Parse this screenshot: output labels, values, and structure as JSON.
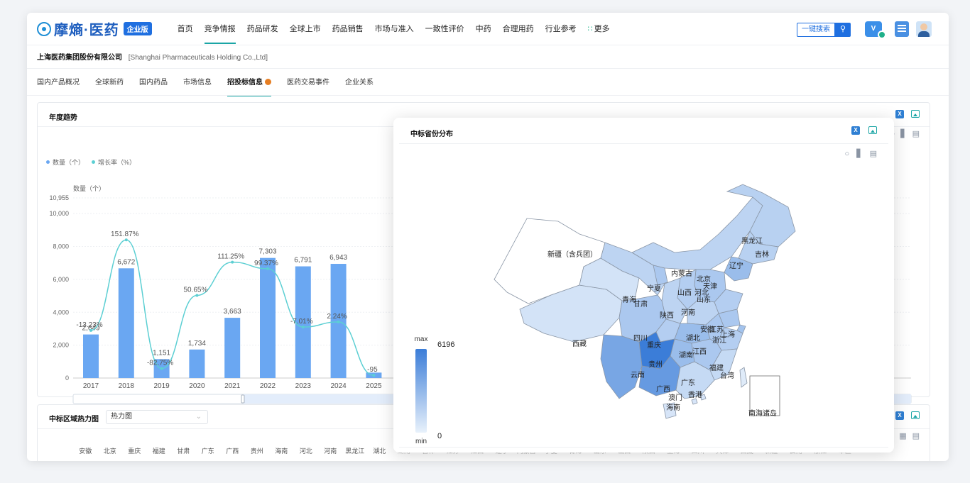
{
  "nav": {
    "brand": "摩熵·医药",
    "badge": "企业版",
    "items": [
      {
        "label": "首页",
        "active": false
      },
      {
        "label": "竞争情报",
        "active": true
      },
      {
        "label": "药品研发",
        "active": false
      },
      {
        "label": "全球上市",
        "active": false
      },
      {
        "label": "药品销售",
        "active": false
      },
      {
        "label": "市场与准入",
        "active": false
      },
      {
        "label": "一致性评价",
        "active": false
      },
      {
        "label": "中药",
        "active": false
      },
      {
        "label": "合理用药",
        "active": false
      },
      {
        "label": "行业参考",
        "active": false
      }
    ],
    "more": "更多",
    "search_label": "一键搜索",
    "vip_label": "V"
  },
  "company": {
    "name_cn": "上海医药集团股份有限公司",
    "name_en": "[Shanghai Pharmaceuticals Holding Co.,Ltd]"
  },
  "subtabs": [
    {
      "label": "国内产品概况",
      "active": false
    },
    {
      "label": "全球新药",
      "active": false
    },
    {
      "label": "国内药品",
      "active": false
    },
    {
      "label": "市场信息",
      "active": false
    },
    {
      "label": "招投标信息",
      "active": true
    },
    {
      "label": "医药交易事件",
      "active": false
    },
    {
      "label": "企业关系",
      "active": false
    }
  ],
  "annual": {
    "title": "年度趋势",
    "legend_count": "数量（个）",
    "legend_rate": "增长率（%）",
    "ylabel": "数量（个）",
    "ymax_label": "10,955"
  },
  "chart_data": [
    {
      "type": "bar",
      "title": "年度趋势",
      "categories": [
        "2017",
        "2018",
        "2019",
        "2020",
        "2021",
        "2022",
        "2023",
        "2024",
        "2025"
      ],
      "series": [
        {
          "name": "数量（个）",
          "type": "bar",
          "values": [
            2649,
            6672,
            1151,
            1734,
            3663,
            7303,
            6791,
            6943,
            330
          ],
          "labels": [
            "2,649",
            "6,672",
            "1,151",
            "1,734",
            "3,663",
            "7,303",
            "6,791",
            "6,943",
            ""
          ]
        },
        {
          "name": "增长率（%）",
          "type": "line",
          "values": [
            -13.23,
            151.87,
            -82.75,
            50.65,
            111.25,
            99.37,
            -7.01,
            2.24,
            -95
          ],
          "labels": [
            "-13.23%",
            "151.87%",
            "-82.75%",
            "50.65%",
            "111.25%",
            "99.37%",
            "-7.01%",
            "2.24%",
            "-95"
          ]
        }
      ],
      "y_ticks": [
        "0",
        "2,000",
        "4,000",
        "6,000",
        "8,000",
        "10,000",
        "10,955"
      ],
      "ylim": [
        0,
        10955
      ],
      "rate_lim": [
        -100,
        200
      ],
      "ylabel": "数量（个）",
      "grid": true,
      "legend": "top-left"
    },
    {
      "type": "heatmap",
      "title": "中标省份分布",
      "legend_max_label": "max",
      "legend_min_label": "min",
      "max_value": "6196",
      "min_value": "0",
      "color_min": "#e8f1fb",
      "color_max": "#3b7dd8",
      "regions": [
        {
          "name": "新疆（含兵团）",
          "level": 0.0
        },
        {
          "name": "西藏",
          "level": 0.12
        },
        {
          "name": "青海",
          "level": 0.12
        },
        {
          "name": "甘肃",
          "level": 0.25
        },
        {
          "name": "内蒙古",
          "level": 0.25
        },
        {
          "name": "宁夏",
          "level": 0.35
        },
        {
          "name": "黑龙江",
          "level": 0.28
        },
        {
          "name": "吉林",
          "level": 0.28
        },
        {
          "name": "辽宁",
          "level": 0.45
        },
        {
          "name": "北京",
          "level": 0.3
        },
        {
          "name": "天津",
          "level": 0.3
        },
        {
          "name": "河北",
          "level": 0.35
        },
        {
          "name": "山西",
          "level": 0.3
        },
        {
          "name": "山东",
          "level": 0.3
        },
        {
          "name": "陕西",
          "level": 0.25
        },
        {
          "name": "河南",
          "level": 0.25
        },
        {
          "name": "四川",
          "level": 0.35
        },
        {
          "name": "重庆",
          "level": 0.3
        },
        {
          "name": "湖北",
          "level": 0.45
        },
        {
          "name": "安徽",
          "level": 0.35
        },
        {
          "name": "江苏",
          "level": 0.35
        },
        {
          "name": "上海",
          "level": 0.4
        },
        {
          "name": "浙江",
          "level": 0.3
        },
        {
          "name": "湖南",
          "level": 0.45
        },
        {
          "name": "江西",
          "level": 0.35
        },
        {
          "name": "福建",
          "level": 0.2
        },
        {
          "name": "台湾",
          "level": 0.05
        },
        {
          "name": "贵州",
          "level": 1.0
        },
        {
          "name": "云南",
          "level": 0.65
        },
        {
          "name": "广西",
          "level": 0.75
        },
        {
          "name": "广东",
          "level": 0.2
        },
        {
          "name": "香港",
          "level": 0.1
        },
        {
          "name": "澳门",
          "level": 0.1
        },
        {
          "name": "海南",
          "level": 0.1
        },
        {
          "name": "南海诸岛",
          "level": 0.0
        }
      ]
    }
  ],
  "modal": {
    "title": "中标省份分布"
  },
  "heat": {
    "title": "中标区域热力图",
    "select_value": "热力图",
    "provinces": [
      {
        "name": "安徽",
        "faded": false
      },
      {
        "name": "北京",
        "faded": false
      },
      {
        "name": "重庆",
        "faded": false
      },
      {
        "name": "福建",
        "faded": false
      },
      {
        "name": "甘肃",
        "faded": false
      },
      {
        "name": "广东",
        "faded": false
      },
      {
        "name": "广西",
        "faded": false
      },
      {
        "name": "贵州",
        "faded": false
      },
      {
        "name": "海南",
        "faded": false
      },
      {
        "name": "河北",
        "faded": false
      },
      {
        "name": "河南",
        "faded": false
      },
      {
        "name": "黑龙江",
        "faded": false
      },
      {
        "name": "湖北",
        "faded": false
      },
      {
        "name": "湖南",
        "faded": true
      },
      {
        "name": "吉林",
        "faded": true
      },
      {
        "name": "江苏",
        "faded": true
      },
      {
        "name": "江西",
        "faded": true
      },
      {
        "name": "辽宁",
        "faded": true
      },
      {
        "name": "内蒙古",
        "faded": true
      },
      {
        "name": "宁夏",
        "faded": true
      },
      {
        "name": "青海",
        "faded": true
      },
      {
        "name": "山东",
        "faded": true
      },
      {
        "name": "山西",
        "faded": true
      },
      {
        "name": "陕西",
        "faded": true
      },
      {
        "name": "上海",
        "faded": true
      },
      {
        "name": "四川",
        "faded": true
      },
      {
        "name": "天津",
        "faded": true
      },
      {
        "name": "西藏",
        "faded": true
      },
      {
        "name": "新疆",
        "faded": true
      },
      {
        "name": "云南",
        "faded": true
      },
      {
        "name": "浙江",
        "faded": true
      },
      {
        "name": "军区",
        "faded": true
      }
    ]
  },
  "colors": {
    "accent": "#1aa5a5",
    "bar": "#6aa7f2",
    "line": "#5ccfd3",
    "brand": "#1f6fe0"
  },
  "icons": {
    "excel": "excel-export-icon",
    "image": "image-export-icon",
    "globe": "map-view-icon",
    "bars": "bar-view-icon",
    "doc": "table-view-icon"
  }
}
